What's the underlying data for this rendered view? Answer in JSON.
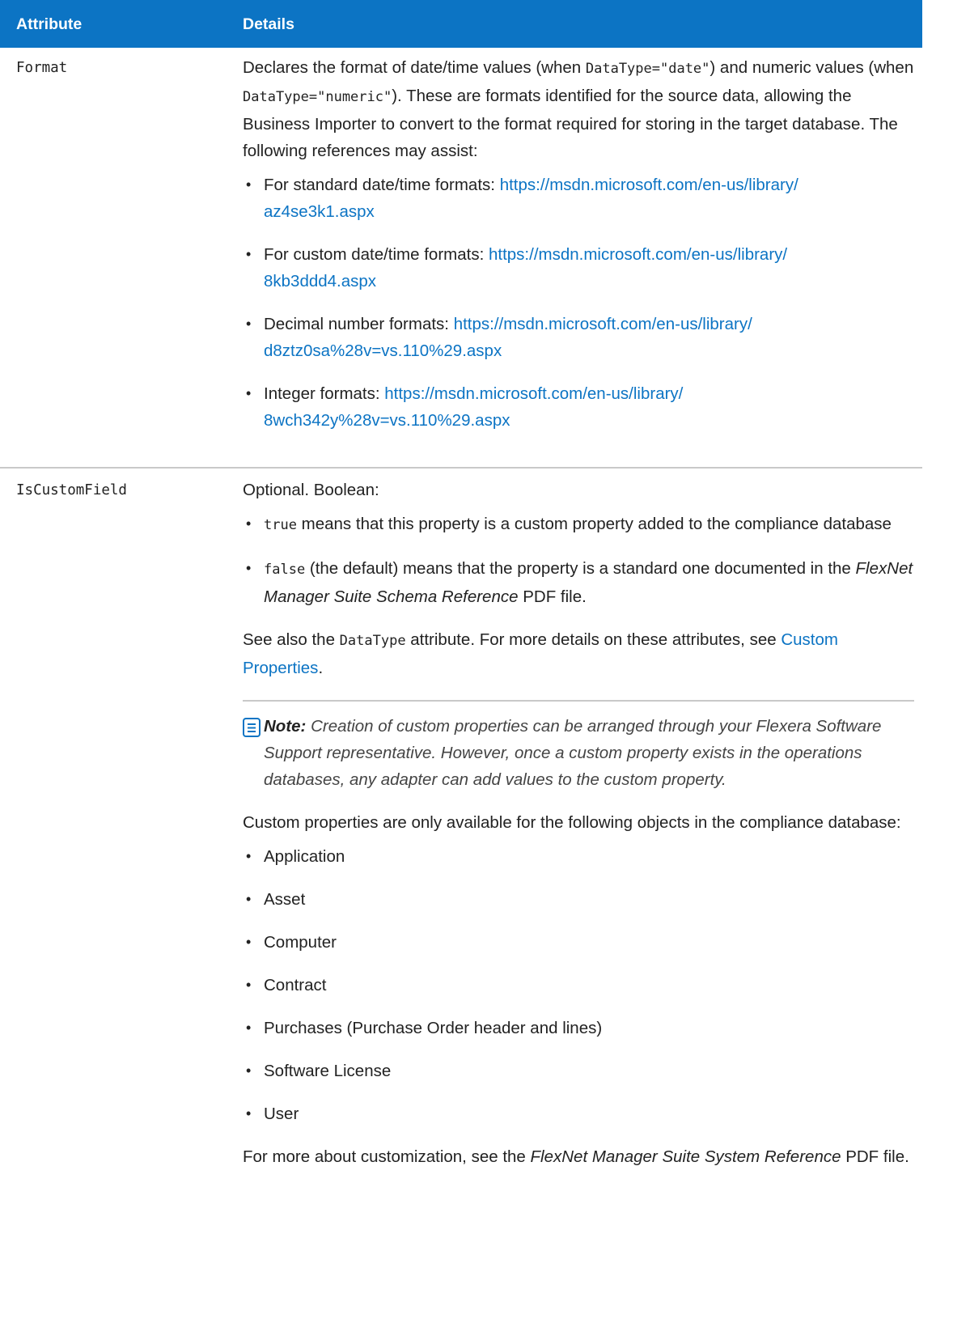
{
  "header": {
    "col1": "Attribute",
    "col2": "Details"
  },
  "rows": [
    {
      "attribute": "Format",
      "intro": [
        "Declares the format of date/time values (when ",
        "DataType=\"date\"",
        ") and numeric values (when ",
        "DataType=\"numeric\"",
        "). These are formats identified for the source data, allowing the Business Importer to convert to the format required for storing in the target database. The following references may assist:"
      ],
      "references": [
        {
          "label": "For standard date/time formats: ",
          "link1": "https://msdn.microsoft.com/en-us/library/",
          "link2": "az4se3k1.aspx"
        },
        {
          "label": "For custom date/time formats: ",
          "link1": "https://msdn.microsoft.com/en-us/library/",
          "link2": "8kb3ddd4.aspx"
        },
        {
          "label": "Decimal number formats: ",
          "link1": "https://msdn.microsoft.com/en-us/library/",
          "link2": "d8ztz0sa%28v=vs.110%29.aspx"
        },
        {
          "label": "Integer formats: ",
          "link1": "https://msdn.microsoft.com/en-us/library/",
          "link2": "8wch342y%28v=vs.110%29.aspx"
        }
      ]
    },
    {
      "attribute": "IsCustomField",
      "intro": "Optional. Boolean:",
      "bool_items": [
        {
          "code": "true",
          "text": " means that this property is a custom property added to the compliance database"
        },
        {
          "code": "false",
          "text_a": " (the default) means that the property is a standard one documented in the ",
          "em": "FlexNet Manager Suite Schema Reference",
          "text_b": " PDF file."
        }
      ],
      "see_also": {
        "a": "See also the ",
        "code": "DataType",
        "b": " attribute. For more details on these attributes, see ",
        "link1": "Custom",
        "link2": "Properties",
        "c": "."
      },
      "note": {
        "label": "Note:",
        "text": " Creation of custom properties can be arranged through your Flexera Software Support representative. However, once a custom property exists in the operations databases, any adapter can add values to the custom property."
      },
      "objects_intro": "Custom properties are only available for the following objects in the compliance database:",
      "objects": [
        "Application",
        "Asset",
        "Computer",
        "Contract",
        "Purchases (Purchase Order header and lines)",
        "Software License",
        "User"
      ],
      "more": {
        "a": "For more about customization, see the ",
        "em": "FlexNet Manager Suite System Reference",
        "b": " PDF file."
      }
    }
  ]
}
